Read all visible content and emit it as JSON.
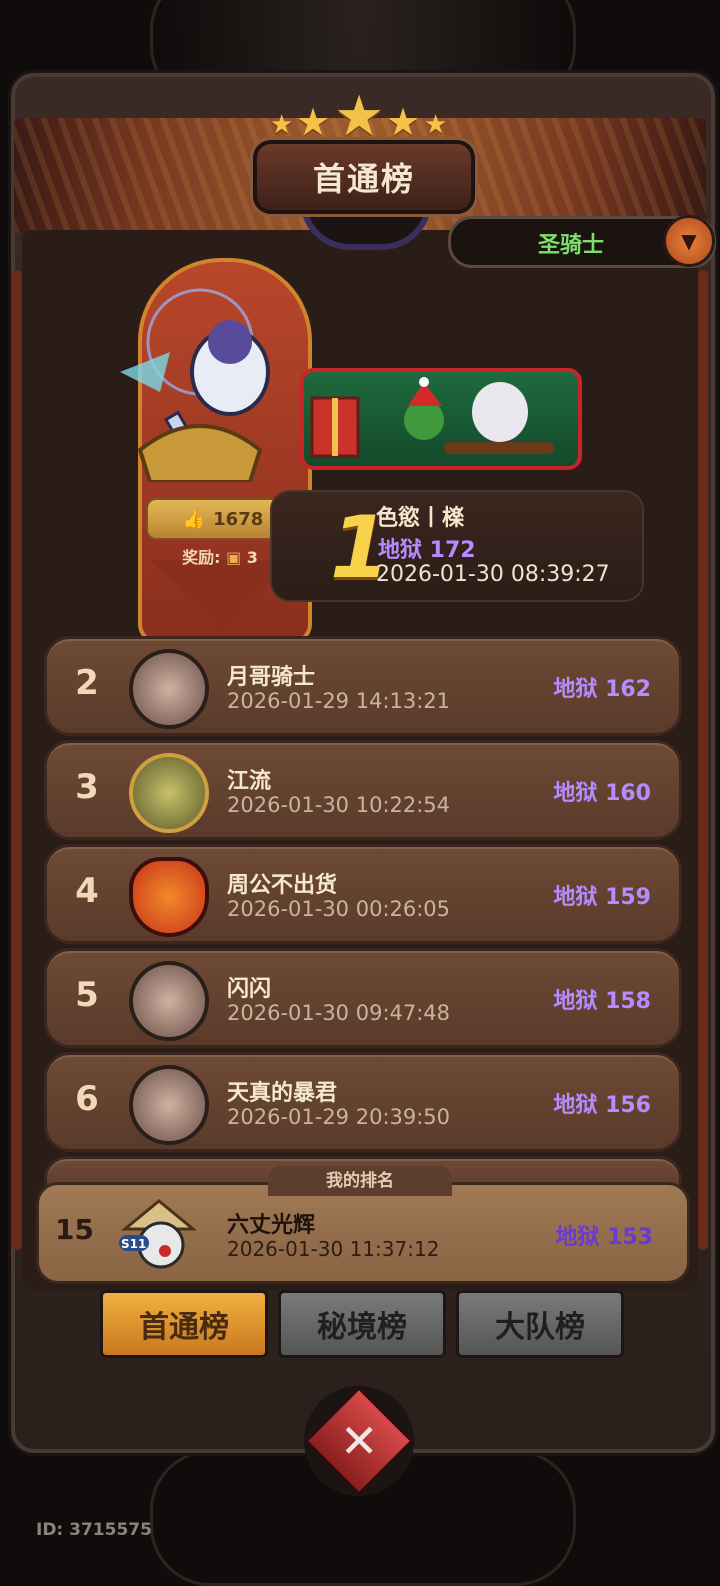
{
  "page": {
    "title": "首通榜",
    "class_selector": "圣骑士",
    "player_id": "ID: 3715575"
  },
  "first_place": {
    "rank": "1",
    "name": "色慾丨檪",
    "score": "地狱 172",
    "time": "2026-01-30 08:39:27",
    "likes": "1678",
    "reward_label": "奖励:",
    "reward_count": "3"
  },
  "leaderboard": [
    {
      "rank": "2",
      "name": "月哥骑士",
      "time": "2026-01-29 14:13:21",
      "score": "地狱 162",
      "avatar_icon": "pig-avatar-icon"
    },
    {
      "rank": "3",
      "name": "江流",
      "time": "2026-01-30 10:22:54",
      "score": "地狱 160",
      "avatar_icon": "dragon-avatar-icon"
    },
    {
      "rank": "4",
      "name": "周公不出货",
      "time": "2026-01-30 00:26:05",
      "score": "地狱 159",
      "avatar_icon": "flame-owl-avatar-icon"
    },
    {
      "rank": "5",
      "name": "闪闪",
      "time": "2026-01-30 09:47:48",
      "score": "地狱 158",
      "avatar_icon": "pig-avatar-icon"
    },
    {
      "rank": "6",
      "name": "天真的暴君",
      "time": "2026-01-29 20:39:50",
      "score": "地狱 156",
      "avatar_icon": "pig-avatar-icon"
    }
  ],
  "my_rank": {
    "label": "我的排名",
    "rank": "15",
    "badge": "S11",
    "name": "六丈光辉",
    "time": "2026-01-30 11:37:12",
    "score": "地狱 153"
  },
  "tabs": [
    "首通榜",
    "秘境榜",
    "大队榜"
  ],
  "colors": {
    "score_purple": "#b58cff",
    "class_green": "#7ee06a",
    "rank_gold": "#f7d24a",
    "tab_active": "#e8a23a"
  }
}
